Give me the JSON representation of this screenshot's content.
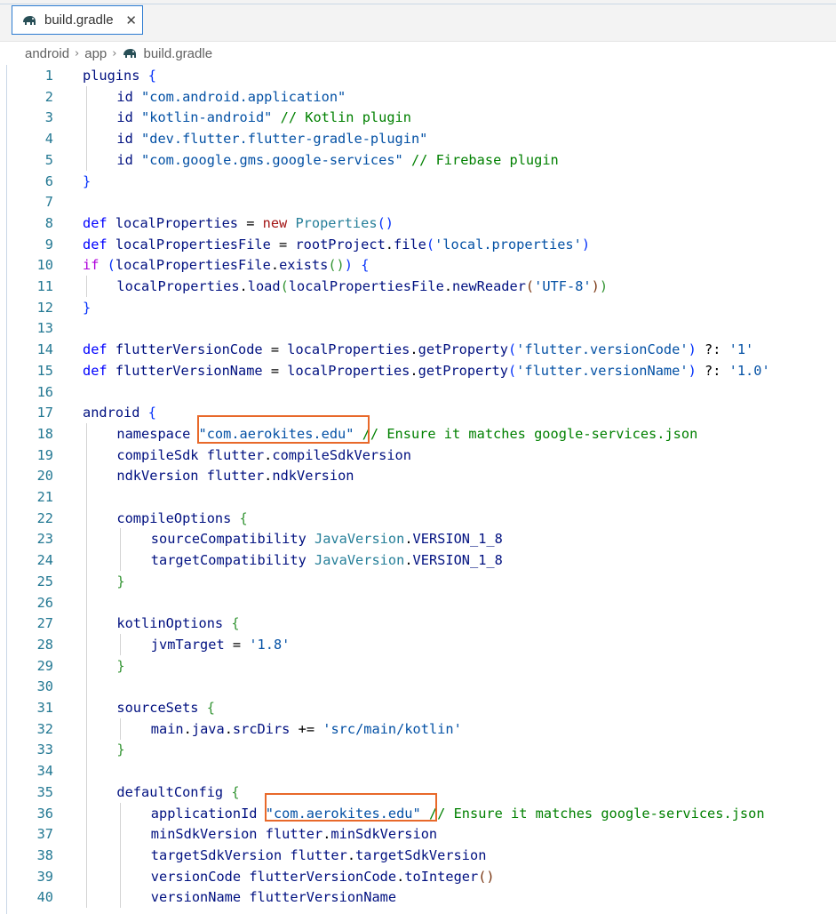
{
  "tab": {
    "title": "build.gradle",
    "close": "✕",
    "icon": "gradle-elephant-icon"
  },
  "breadcrumb": {
    "items": [
      "android",
      "app",
      "build.gradle"
    ],
    "separator": "›"
  },
  "highlight_color": "#e8692a",
  "editor": {
    "lines": [
      {
        "n": "1",
        "tokens": [
          [
            "v",
            "plugins "
          ],
          [
            "p1",
            "{"
          ]
        ]
      },
      {
        "n": "2",
        "tokens": [
          [
            "v",
            "id "
          ],
          [
            "s2",
            "\"com.android.application\""
          ]
        ]
      },
      {
        "n": "3",
        "tokens": [
          [
            "v",
            "id "
          ],
          [
            "s2",
            "\"kotlin-android\""
          ],
          [
            "x",
            " "
          ],
          [
            "c",
            "// Kotlin plugin"
          ]
        ]
      },
      {
        "n": "4",
        "tokens": [
          [
            "v",
            "id "
          ],
          [
            "s2",
            "\"dev.flutter.flutter-gradle-plugin\""
          ]
        ]
      },
      {
        "n": "5",
        "tokens": [
          [
            "v",
            "id "
          ],
          [
            "s2",
            "\"com.google.gms.google-services\""
          ],
          [
            "x",
            " "
          ],
          [
            "c",
            "// Firebase plugin"
          ]
        ]
      },
      {
        "n": "6",
        "tokens": [
          [
            "p1",
            "}"
          ]
        ]
      },
      {
        "n": "7",
        "tokens": []
      },
      {
        "n": "8",
        "tokens": [
          [
            "k",
            "def "
          ],
          [
            "v",
            "localProperties "
          ],
          [
            "x",
            "= "
          ],
          [
            "s",
            "new "
          ],
          [
            "t",
            "Properties"
          ],
          [
            "p1",
            "()"
          ]
        ]
      },
      {
        "n": "9",
        "tokens": [
          [
            "k",
            "def "
          ],
          [
            "v",
            "localPropertiesFile "
          ],
          [
            "x",
            "= "
          ],
          [
            "v",
            "rootProject"
          ],
          [
            "x",
            "."
          ],
          [
            "v",
            "file"
          ],
          [
            "p1",
            "("
          ],
          [
            "s2",
            "'local.properties'"
          ],
          [
            "p1",
            ")"
          ]
        ]
      },
      {
        "n": "10",
        "tokens": [
          [
            "kw",
            "if "
          ],
          [
            "p1",
            "("
          ],
          [
            "v",
            "localPropertiesFile"
          ],
          [
            "x",
            "."
          ],
          [
            "v",
            "exists"
          ],
          [
            "p2",
            "()"
          ],
          [
            "p1",
            ")"
          ],
          [
            "x",
            " "
          ],
          [
            "p1",
            "{"
          ]
        ]
      },
      {
        "n": "11",
        "tokens": [
          [
            "v",
            "localProperties"
          ],
          [
            "x",
            "."
          ],
          [
            "v",
            "load"
          ],
          [
            "p2",
            "("
          ],
          [
            "v",
            "localPropertiesFile"
          ],
          [
            "x",
            "."
          ],
          [
            "v",
            "newReader"
          ],
          [
            "p3",
            "("
          ],
          [
            "s2",
            "'UTF-8'"
          ],
          [
            "p3",
            ")"
          ],
          [
            "p2",
            ")"
          ]
        ]
      },
      {
        "n": "12",
        "tokens": [
          [
            "p1",
            "}"
          ]
        ]
      },
      {
        "n": "13",
        "tokens": []
      },
      {
        "n": "14",
        "tokens": [
          [
            "k",
            "def "
          ],
          [
            "v",
            "flutterVersionCode "
          ],
          [
            "x",
            "= "
          ],
          [
            "v",
            "localProperties"
          ],
          [
            "x",
            "."
          ],
          [
            "v",
            "getProperty"
          ],
          [
            "p1",
            "("
          ],
          [
            "s2",
            "'flutter.versionCode'"
          ],
          [
            "p1",
            ")"
          ],
          [
            "x",
            " ?: "
          ],
          [
            "s2",
            "'1'"
          ]
        ]
      },
      {
        "n": "15",
        "tokens": [
          [
            "k",
            "def "
          ],
          [
            "v",
            "flutterVersionName "
          ],
          [
            "x",
            "= "
          ],
          [
            "v",
            "localProperties"
          ],
          [
            "x",
            "."
          ],
          [
            "v",
            "getProperty"
          ],
          [
            "p1",
            "("
          ],
          [
            "s2",
            "'flutter.versionName'"
          ],
          [
            "p1",
            ")"
          ],
          [
            "x",
            " ?: "
          ],
          [
            "s2",
            "'1.0'"
          ]
        ]
      },
      {
        "n": "16",
        "tokens": []
      },
      {
        "n": "17",
        "tokens": [
          [
            "v",
            "android "
          ],
          [
            "p1",
            "{"
          ]
        ]
      },
      {
        "n": "18",
        "tokens": [
          [
            "v",
            "namespace "
          ],
          [
            "s2",
            "\"com.aerokites.edu\""
          ],
          [
            "x",
            " "
          ],
          [
            "c",
            "// Ensure it matches google-services.json"
          ]
        ]
      },
      {
        "n": "19",
        "tokens": [
          [
            "v",
            "compileSdk "
          ],
          [
            "v",
            "flutter"
          ],
          [
            "x",
            "."
          ],
          [
            "v",
            "compileSdkVersion"
          ]
        ]
      },
      {
        "n": "20",
        "tokens": [
          [
            "v",
            "ndkVersion "
          ],
          [
            "v",
            "flutter"
          ],
          [
            "x",
            "."
          ],
          [
            "v",
            "ndkVersion"
          ]
        ]
      },
      {
        "n": "21",
        "tokens": []
      },
      {
        "n": "22",
        "tokens": [
          [
            "v",
            "compileOptions "
          ],
          [
            "p2",
            "{"
          ]
        ]
      },
      {
        "n": "23",
        "tokens": [
          [
            "v",
            "sourceCompatibility "
          ],
          [
            "t",
            "JavaVersion"
          ],
          [
            "x",
            "."
          ],
          [
            "v",
            "VERSION_1_8"
          ]
        ]
      },
      {
        "n": "24",
        "tokens": [
          [
            "v",
            "targetCompatibility "
          ],
          [
            "t",
            "JavaVersion"
          ],
          [
            "x",
            "."
          ],
          [
            "v",
            "VERSION_1_8"
          ]
        ]
      },
      {
        "n": "25",
        "tokens": [
          [
            "p2",
            "}"
          ]
        ]
      },
      {
        "n": "26",
        "tokens": []
      },
      {
        "n": "27",
        "tokens": [
          [
            "v",
            "kotlinOptions "
          ],
          [
            "p2",
            "{"
          ]
        ]
      },
      {
        "n": "28",
        "tokens": [
          [
            "v",
            "jvmTarget "
          ],
          [
            "x",
            "= "
          ],
          [
            "s2",
            "'1.8'"
          ]
        ]
      },
      {
        "n": "29",
        "tokens": [
          [
            "p2",
            "}"
          ]
        ]
      },
      {
        "n": "30",
        "tokens": []
      },
      {
        "n": "31",
        "tokens": [
          [
            "v",
            "sourceSets "
          ],
          [
            "p2",
            "{"
          ]
        ]
      },
      {
        "n": "32",
        "tokens": [
          [
            "v",
            "main"
          ],
          [
            "x",
            "."
          ],
          [
            "v",
            "java"
          ],
          [
            "x",
            "."
          ],
          [
            "v",
            "srcDirs "
          ],
          [
            "x",
            "+= "
          ],
          [
            "s2",
            "'src/main/kotlin'"
          ]
        ]
      },
      {
        "n": "33",
        "tokens": [
          [
            "p2",
            "}"
          ]
        ]
      },
      {
        "n": "34",
        "tokens": []
      },
      {
        "n": "35",
        "tokens": [
          [
            "v",
            "defaultConfig "
          ],
          [
            "p2",
            "{"
          ]
        ]
      },
      {
        "n": "36",
        "tokens": [
          [
            "v",
            "applicationId "
          ],
          [
            "s2",
            "\"com.aerokites.edu\""
          ],
          [
            "x",
            " "
          ],
          [
            "c",
            "// Ensure it matches google-services.json"
          ]
        ]
      },
      {
        "n": "37",
        "tokens": [
          [
            "v",
            "minSdkVersion "
          ],
          [
            "v",
            "flutter"
          ],
          [
            "x",
            "."
          ],
          [
            "v",
            "minSdkVersion"
          ]
        ]
      },
      {
        "n": "38",
        "tokens": [
          [
            "v",
            "targetSdkVersion "
          ],
          [
            "v",
            "flutter"
          ],
          [
            "x",
            "."
          ],
          [
            "v",
            "targetSdkVersion"
          ]
        ]
      },
      {
        "n": "39",
        "tokens": [
          [
            "v",
            "versionCode "
          ],
          [
            "v",
            "flutterVersionCode"
          ],
          [
            "x",
            "."
          ],
          [
            "v",
            "toInteger"
          ],
          [
            "p3",
            "()"
          ]
        ]
      },
      {
        "n": "40",
        "tokens": [
          [
            "v",
            "versionName "
          ],
          [
            "v",
            "flutterVersionName"
          ]
        ]
      }
    ]
  }
}
